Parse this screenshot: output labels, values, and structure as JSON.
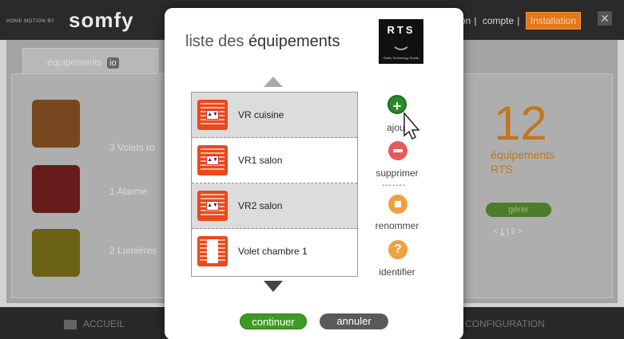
{
  "app": {
    "logo_small": "HOME MOTION BY",
    "logo": "somfy",
    "links": [
      "on",
      "compte"
    ],
    "install_label": "Installation",
    "tab_label": "équipements",
    "tab_badge": "io",
    "categories": [
      {
        "label": "3 Volets ro",
        "icon": "roller-shutter-icon"
      },
      {
        "label": "1 Alarme",
        "icon": "alarm-house-icon"
      },
      {
        "label": "2 Lumières",
        "icon": "light-bulb-icon"
      }
    ],
    "count": "12",
    "count_line1": "équipements",
    "count_line2": "RTS",
    "manage_label": "gérer",
    "pager": [
      "<",
      "1",
      "|",
      "2",
      ">"
    ],
    "bottom_left": "ACCUEIL",
    "bottom_right": "CONFIGURATION"
  },
  "modal": {
    "title_prefix": "liste des ",
    "title_strong": "équipements",
    "rts_logo": "RTS",
    "rts_sub": "Radio Technology Somfy",
    "items": [
      {
        "label": "VR cuisine",
        "selected": true,
        "icon": "roller-shutter-icon"
      },
      {
        "label": "VR1 salon",
        "selected": false,
        "icon": "roller-shutter-icon"
      },
      {
        "label": "VR2 salon",
        "selected": true,
        "icon": "roller-shutter-icon"
      },
      {
        "label": "Volet chambre 1",
        "selected": false,
        "icon": "swing-shutter-icon"
      }
    ],
    "actions": {
      "add": "ajout",
      "delete": "supprimer",
      "separator": "-------",
      "rename": "renommer",
      "identify": "identifier"
    },
    "continue_label": "continuer",
    "cancel_label": "annuler"
  },
  "colors": {
    "accent_orange": "#e8491e",
    "add_green": "#2a8a2a",
    "delete_red": "#e85a5a",
    "rename_orange": "#f0a040",
    "continue_green": "#3f9a22"
  }
}
